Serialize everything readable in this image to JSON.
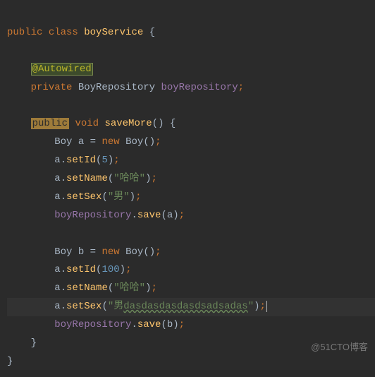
{
  "code": {
    "l1": {
      "public": "public",
      "class": "class",
      "name": "boyService",
      "brace": "{"
    },
    "l3": {
      "anno": "@Autowired"
    },
    "l4": {
      "private": "private",
      "type": "BoyRepository",
      "field": "boyRepository",
      "semi": ";"
    },
    "l6": {
      "public": "public",
      "void": "void",
      "method": "saveMore",
      "parens": "()",
      "brace": "{"
    },
    "l7": {
      "type": "Boy",
      "var": "a",
      "eq": "=",
      "new": "new",
      "ctor": "Boy",
      "parens": "()",
      "semi": ";"
    },
    "l8": {
      "obj": "a",
      "dot": ".",
      "method": "setId",
      "lp": "(",
      "arg": "5",
      "rp": ")",
      "semi": ";"
    },
    "l9": {
      "obj": "a",
      "dot": ".",
      "method": "setName",
      "lp": "(",
      "arg": "\"哈哈\"",
      "rp": ")",
      "semi": ";"
    },
    "l10": {
      "obj": "a",
      "dot": ".",
      "method": "setSex",
      "lp": "(",
      "arg": "\"男\"",
      "rp": ")",
      "semi": ";"
    },
    "l11": {
      "obj": "boyRepository",
      "dot": ".",
      "method": "save",
      "lp": "(",
      "arg": "a",
      "rp": ")",
      "semi": ";"
    },
    "l13": {
      "type": "Boy",
      "var": "b",
      "eq": "=",
      "new": "new",
      "ctor": "Boy",
      "parens": "()",
      "semi": ";"
    },
    "l14": {
      "obj": "a",
      "dot": ".",
      "method": "setId",
      "lp": "(",
      "arg": "100",
      "rp": ")",
      "semi": ";"
    },
    "l15": {
      "obj": "a",
      "dot": ".",
      "method": "setName",
      "lp": "(",
      "arg": "\"哈哈\"",
      "rp": ")",
      "semi": ";"
    },
    "l16": {
      "obj": "a",
      "dot": ".",
      "method": "setSex",
      "lp": "(",
      "q1": "\"男",
      "wavy": "dasdasdasdasdsadsadas",
      "q2": "\"",
      "rp": ")",
      "semi": ";"
    },
    "l17": {
      "obj": "boyRepository",
      "dot": ".",
      "method": "save",
      "lp": "(",
      "arg": "b",
      "rp": ")",
      "semi": ";"
    },
    "l18": {
      "brace": "}"
    },
    "l19": {
      "brace": "}"
    }
  },
  "watermark": "@51CTO博客"
}
